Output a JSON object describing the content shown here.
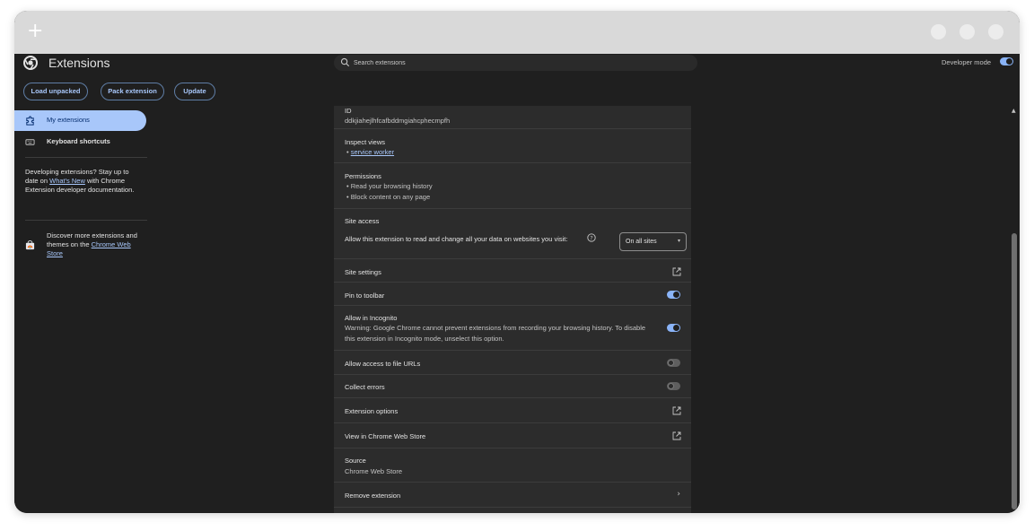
{
  "browser": {
    "new_tab_symbol": "+"
  },
  "header": {
    "title": "Extensions",
    "search_placeholder": "Search extensions",
    "developer_mode_label": "Developer mode",
    "developer_mode_on": true
  },
  "toolbar": {
    "load_unpacked": "Load unpacked",
    "pack_extension": "Pack extension",
    "update": "Update"
  },
  "sidebar": {
    "items": [
      {
        "label": "My extensions",
        "icon": "puzzle-icon",
        "active": true
      },
      {
        "label": "Keyboard shortcuts",
        "icon": "keyboard-icon",
        "active": false
      }
    ],
    "dev_note_prefix": "Developing extensions? Stay up to date on ",
    "dev_note_link": "What's New",
    "dev_note_suffix": " with Chrome Extension developer documentation.",
    "store_note_text": "Discover more extensions and themes on the ",
    "store_note_link": "Chrome Web Store"
  },
  "details": {
    "id_label": "ID",
    "id_value": "ddkjiahejlhfcafbddmgiahcphecmpfh",
    "inspect_views_title": "Inspect views",
    "inspect_views_link": "service worker",
    "permissions_title": "Permissions",
    "permissions": [
      "Read your browsing history",
      "Block content on any page"
    ],
    "site_access_title": "Site access",
    "site_access_prompt": "Allow this extension to read and change all your data on websites you visit:",
    "site_access_value": "On all sites",
    "site_settings": "Site settings",
    "pin_to_toolbar": "Pin to toolbar",
    "pin_to_toolbar_on": true,
    "allow_incognito_title": "Allow in Incognito",
    "allow_incognito_warning_1": "Warning: Google Chrome cannot prevent extensions from recording your browsing history. To disable",
    "allow_incognito_warning_2": "this extension in Incognito mode, unselect this option.",
    "allow_incognito_on": true,
    "file_urls": "Allow access to file URLs",
    "file_urls_on": false,
    "collect_errors": "Collect errors",
    "collect_errors_on": false,
    "extension_options": "Extension options",
    "view_in_store": "View in Chrome Web Store",
    "source_title": "Source",
    "source_value": "Chrome Web Store",
    "remove_extension": "Remove extension",
    "remove_chevron": "›"
  },
  "colors": {
    "accent": "#a8c7fa",
    "toggle_on": "#8ab4f8",
    "background": "#1f1f1f",
    "card": "#2c2c2c",
    "titlebar": "#d9d9d9"
  }
}
